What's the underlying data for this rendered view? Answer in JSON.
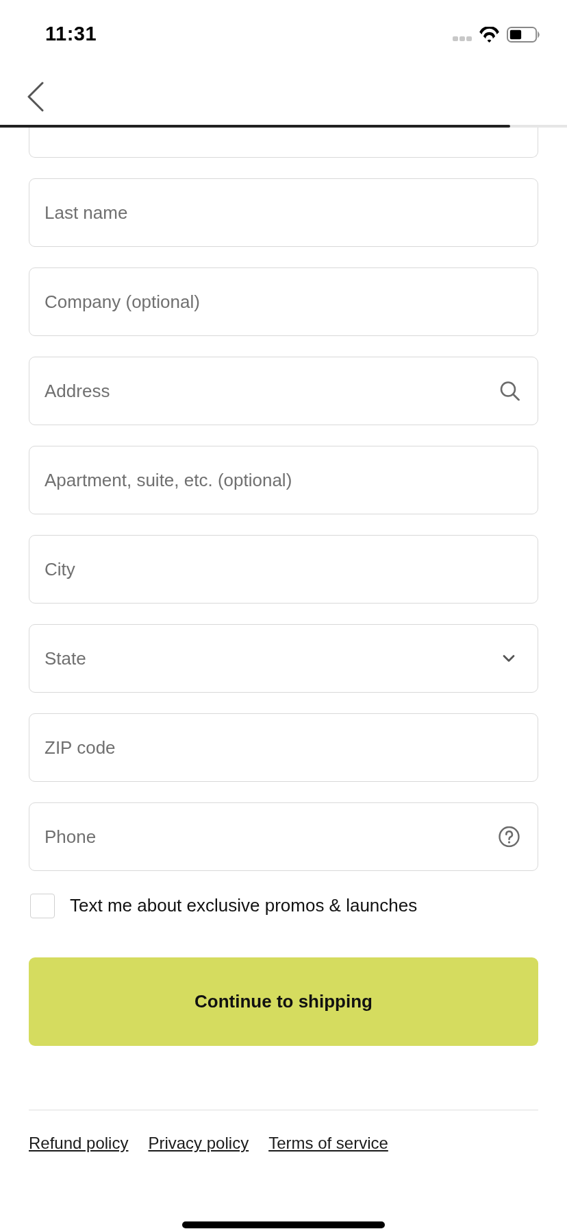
{
  "status_bar": {
    "time": "11:31"
  },
  "header": {
    "progress": {
      "level": 0.9
    }
  },
  "fields": [
    {
      "kind": "partial"
    },
    {
      "kind": "text",
      "placeholder": "Last name"
    },
    {
      "kind": "text",
      "placeholder": "Company (optional)"
    },
    {
      "kind": "search",
      "placeholder": "Address"
    },
    {
      "kind": "text",
      "placeholder": "Apartment, suite, etc. (optional)"
    },
    {
      "kind": "text",
      "placeholder": "City"
    },
    {
      "kind": "select",
      "placeholder": "State"
    },
    {
      "kind": "text",
      "placeholder": "ZIP code"
    },
    {
      "kind": "help",
      "placeholder": "Phone"
    }
  ],
  "sms_opt_in": {
    "label": "Text me about exclusive promos & launches",
    "checked": false
  },
  "continue_button": {
    "label": "Continue to shipping"
  },
  "footer_links": [
    "Refund policy",
    "Privacy policy",
    "Terms of service"
  ]
}
